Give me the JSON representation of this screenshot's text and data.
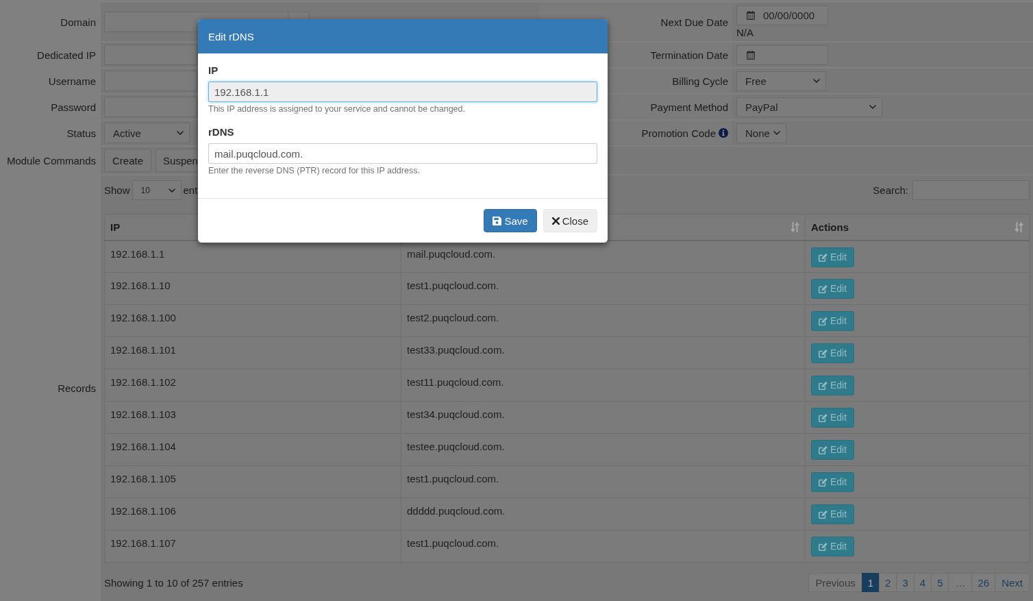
{
  "form": {
    "left_fields": [
      {
        "label": "Domain",
        "kind": "input-addon"
      },
      {
        "label": "Dedicated IP",
        "kind": "input"
      },
      {
        "label": "Username",
        "kind": "input"
      },
      {
        "label": "Password",
        "kind": "input"
      },
      {
        "label": "Status",
        "kind": "select",
        "value": "Active"
      }
    ],
    "right_fields": [
      {
        "label": "Next Due Date",
        "kind": "date",
        "value": "00/00/0000",
        "note": "N/A",
        "info": false
      },
      {
        "label": "Termination Date",
        "kind": "date",
        "info": false
      },
      {
        "label": "Billing Cycle",
        "kind": "select",
        "value": "Free",
        "info": false
      },
      {
        "label": "Payment Method",
        "kind": "select",
        "value": "PayPal",
        "info": false
      },
      {
        "label": "Promotion Code",
        "kind": "select",
        "value": "None",
        "info": true
      }
    ]
  },
  "module_commands": {
    "label": "Module Commands",
    "buttons": [
      "Create",
      "Suspen"
    ]
  },
  "records": {
    "label": "Records",
    "show_label": "Show",
    "page_length": "10",
    "entries_label": "ent",
    "search_label": "Search:",
    "table": {
      "columns": [
        {
          "label": "IP",
          "sort_icon": false
        },
        {
          "sort_icon": true
        },
        {
          "label": "Actions",
          "sort_icon": true
        }
      ],
      "rows": [
        {
          "ip": "192.168.1.1",
          "rdns": "mail.puqcloud.com.",
          "action": "Edit"
        },
        {
          "ip": "192.168.1.10",
          "rdns": "test1.puqcloud.com.",
          "action": "Edit"
        },
        {
          "ip": "192.168.1.100",
          "rdns": "test2.puqcloud.com.",
          "action": "Edit"
        },
        {
          "ip": "192.168.1.101",
          "rdns": "test33.puqcloud.com.",
          "action": "Edit"
        },
        {
          "ip": "192.168.1.102",
          "rdns": "test11.puqcloud.com.",
          "action": "Edit"
        },
        {
          "ip": "192.168.1.103",
          "rdns": "test34.puqcloud.com.",
          "action": "Edit"
        },
        {
          "ip": "192.168.1.104",
          "rdns": "testee.puqcloud.com.",
          "action": "Edit"
        },
        {
          "ip": "192.168.1.105",
          "rdns": "test1.puqcloud.com.",
          "action": "Edit"
        },
        {
          "ip": "192.168.1.106",
          "rdns": "ddddd.puqcloud.com.",
          "action": "Edit"
        },
        {
          "ip": "192.168.1.107",
          "rdns": "test1.puqcloud.com.",
          "action": "Edit"
        }
      ]
    },
    "info": "Showing 1 to 10 of 257 entries",
    "pagination": [
      {
        "label": "Previous",
        "kind": "prev",
        "selected": false,
        "disabled": true
      },
      {
        "label": "1",
        "kind": "page",
        "selected": true,
        "disabled": false
      },
      {
        "label": "2",
        "kind": "page",
        "selected": false,
        "disabled": false
      },
      {
        "label": "3",
        "kind": "page",
        "selected": false,
        "disabled": false
      },
      {
        "label": "4",
        "kind": "page",
        "selected": false,
        "disabled": false
      },
      {
        "label": "5",
        "kind": "page",
        "selected": false,
        "disabled": false
      },
      {
        "label": "…",
        "kind": "ellipsis",
        "selected": false,
        "disabled": true
      },
      {
        "label": "26",
        "kind": "page",
        "selected": false,
        "disabled": false
      },
      {
        "label": "Next",
        "kind": "next",
        "selected": false,
        "disabled": false
      }
    ]
  },
  "dialog": {
    "title": "Edit rDNS",
    "fields": [
      {
        "label": "IP",
        "value": "192.168.1.1",
        "readonly": true,
        "focused": true,
        "help": "This IP address is assigned to your service and cannot be changed."
      },
      {
        "label": "rDNS",
        "value": "mail.puqcloud.com.",
        "readonly": false,
        "focused": false,
        "help": "Enter the reverse DNS (PTR) record for this IP address."
      }
    ],
    "buttons": [
      {
        "label": "Save",
        "kind": "primary"
      },
      {
        "label": "Close",
        "kind": "default"
      }
    ]
  }
}
